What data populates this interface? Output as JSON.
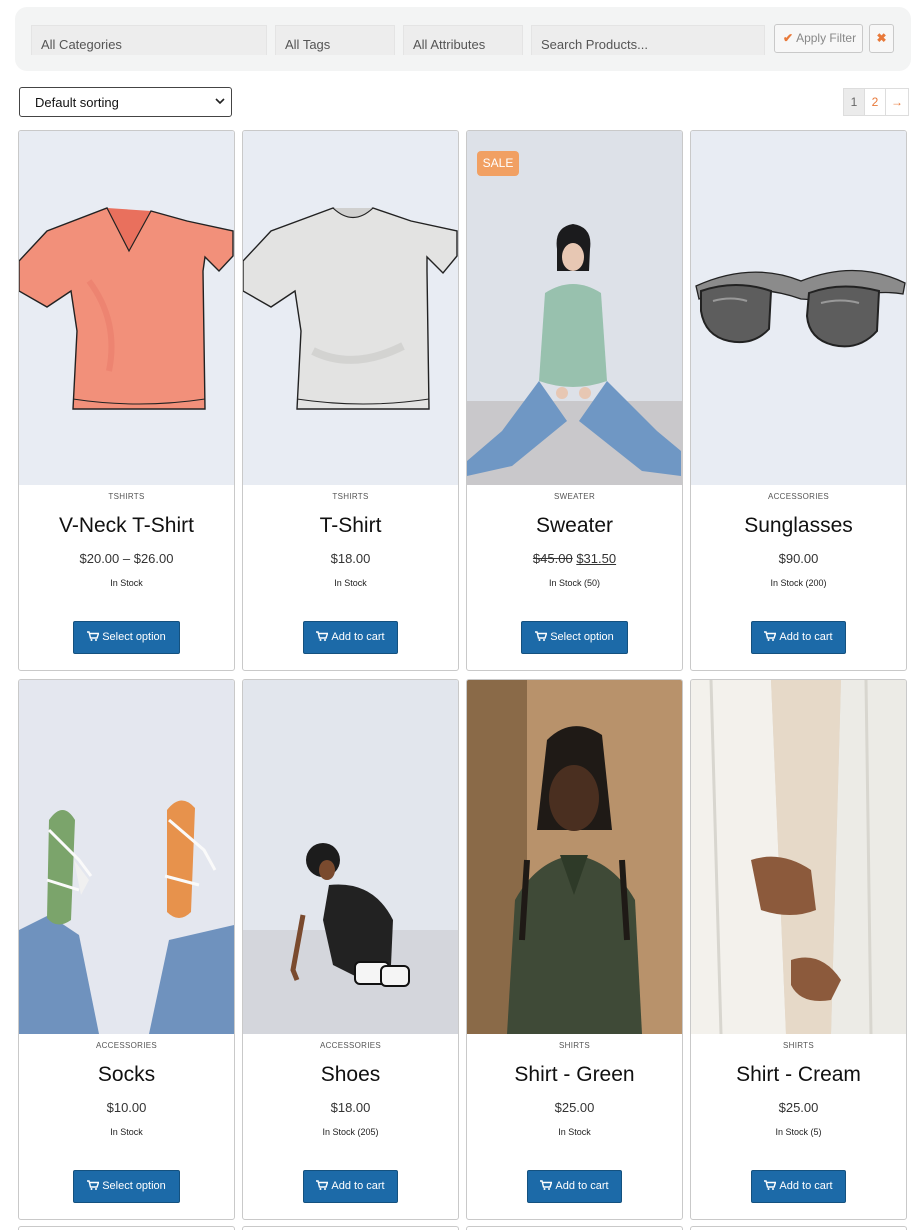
{
  "filters": {
    "categories": "All Categories",
    "tags": "All Tags",
    "attributes": "All Attributes",
    "search_placeholder": "Search Products...",
    "apply_label": "Apply Filter",
    "clear_icon": "close-icon"
  },
  "sorting": {
    "selected": "Default sorting"
  },
  "pagination": {
    "current": "1",
    "pages": [
      "1",
      "2"
    ],
    "next_icon": "arrow-right-icon"
  },
  "colors": {
    "accent": "#e8793a",
    "button": "#1c6aa8",
    "sale": "#f1a063"
  },
  "products": [
    {
      "category": "TSHIRTS",
      "title": "V-Neck T-Shirt",
      "price": "$20.00 – $26.00",
      "stock": "In Stock",
      "button": "Select option",
      "image": "vneck-tshirt-illustration"
    },
    {
      "category": "TSHIRTS",
      "title": "T-Shirt",
      "price": "$18.00",
      "stock": "In Stock",
      "button": "Add to cart",
      "image": "tshirt-illustration"
    },
    {
      "category": "SWEATER",
      "title": "Sweater",
      "price_old": "$45.00",
      "price_new": "$31.50",
      "stock": "In Stock (50)",
      "button": "Select option",
      "badge": "SALE",
      "image": "woman-in-sweater-photo"
    },
    {
      "category": "ACCESSORIES",
      "title": "Sunglasses",
      "price": "$90.00",
      "stock": "In Stock (200)",
      "button": "Add to cart",
      "image": "sunglasses-illustration"
    },
    {
      "category": "ACCESSORIES",
      "title": "Socks",
      "price": "$10.00",
      "stock": "In Stock",
      "button": "Select option",
      "image": "socks-photo"
    },
    {
      "category": "ACCESSORIES",
      "title": "Shoes",
      "price": "$18.00",
      "stock": "In Stock (205)",
      "button": "Add to cart",
      "image": "woman-crouching-shoes-photo"
    },
    {
      "category": "SHIRTS",
      "title": "Shirt - Green",
      "price": "$25.00",
      "stock": "In Stock",
      "button": "Add to cart",
      "image": "man-green-shirt-photo"
    },
    {
      "category": "SHIRTS",
      "title": "Shirt - Cream",
      "price": "$25.00",
      "stock": "In Stock (5)",
      "button": "Add to cart",
      "image": "cream-shirt-photo"
    }
  ]
}
